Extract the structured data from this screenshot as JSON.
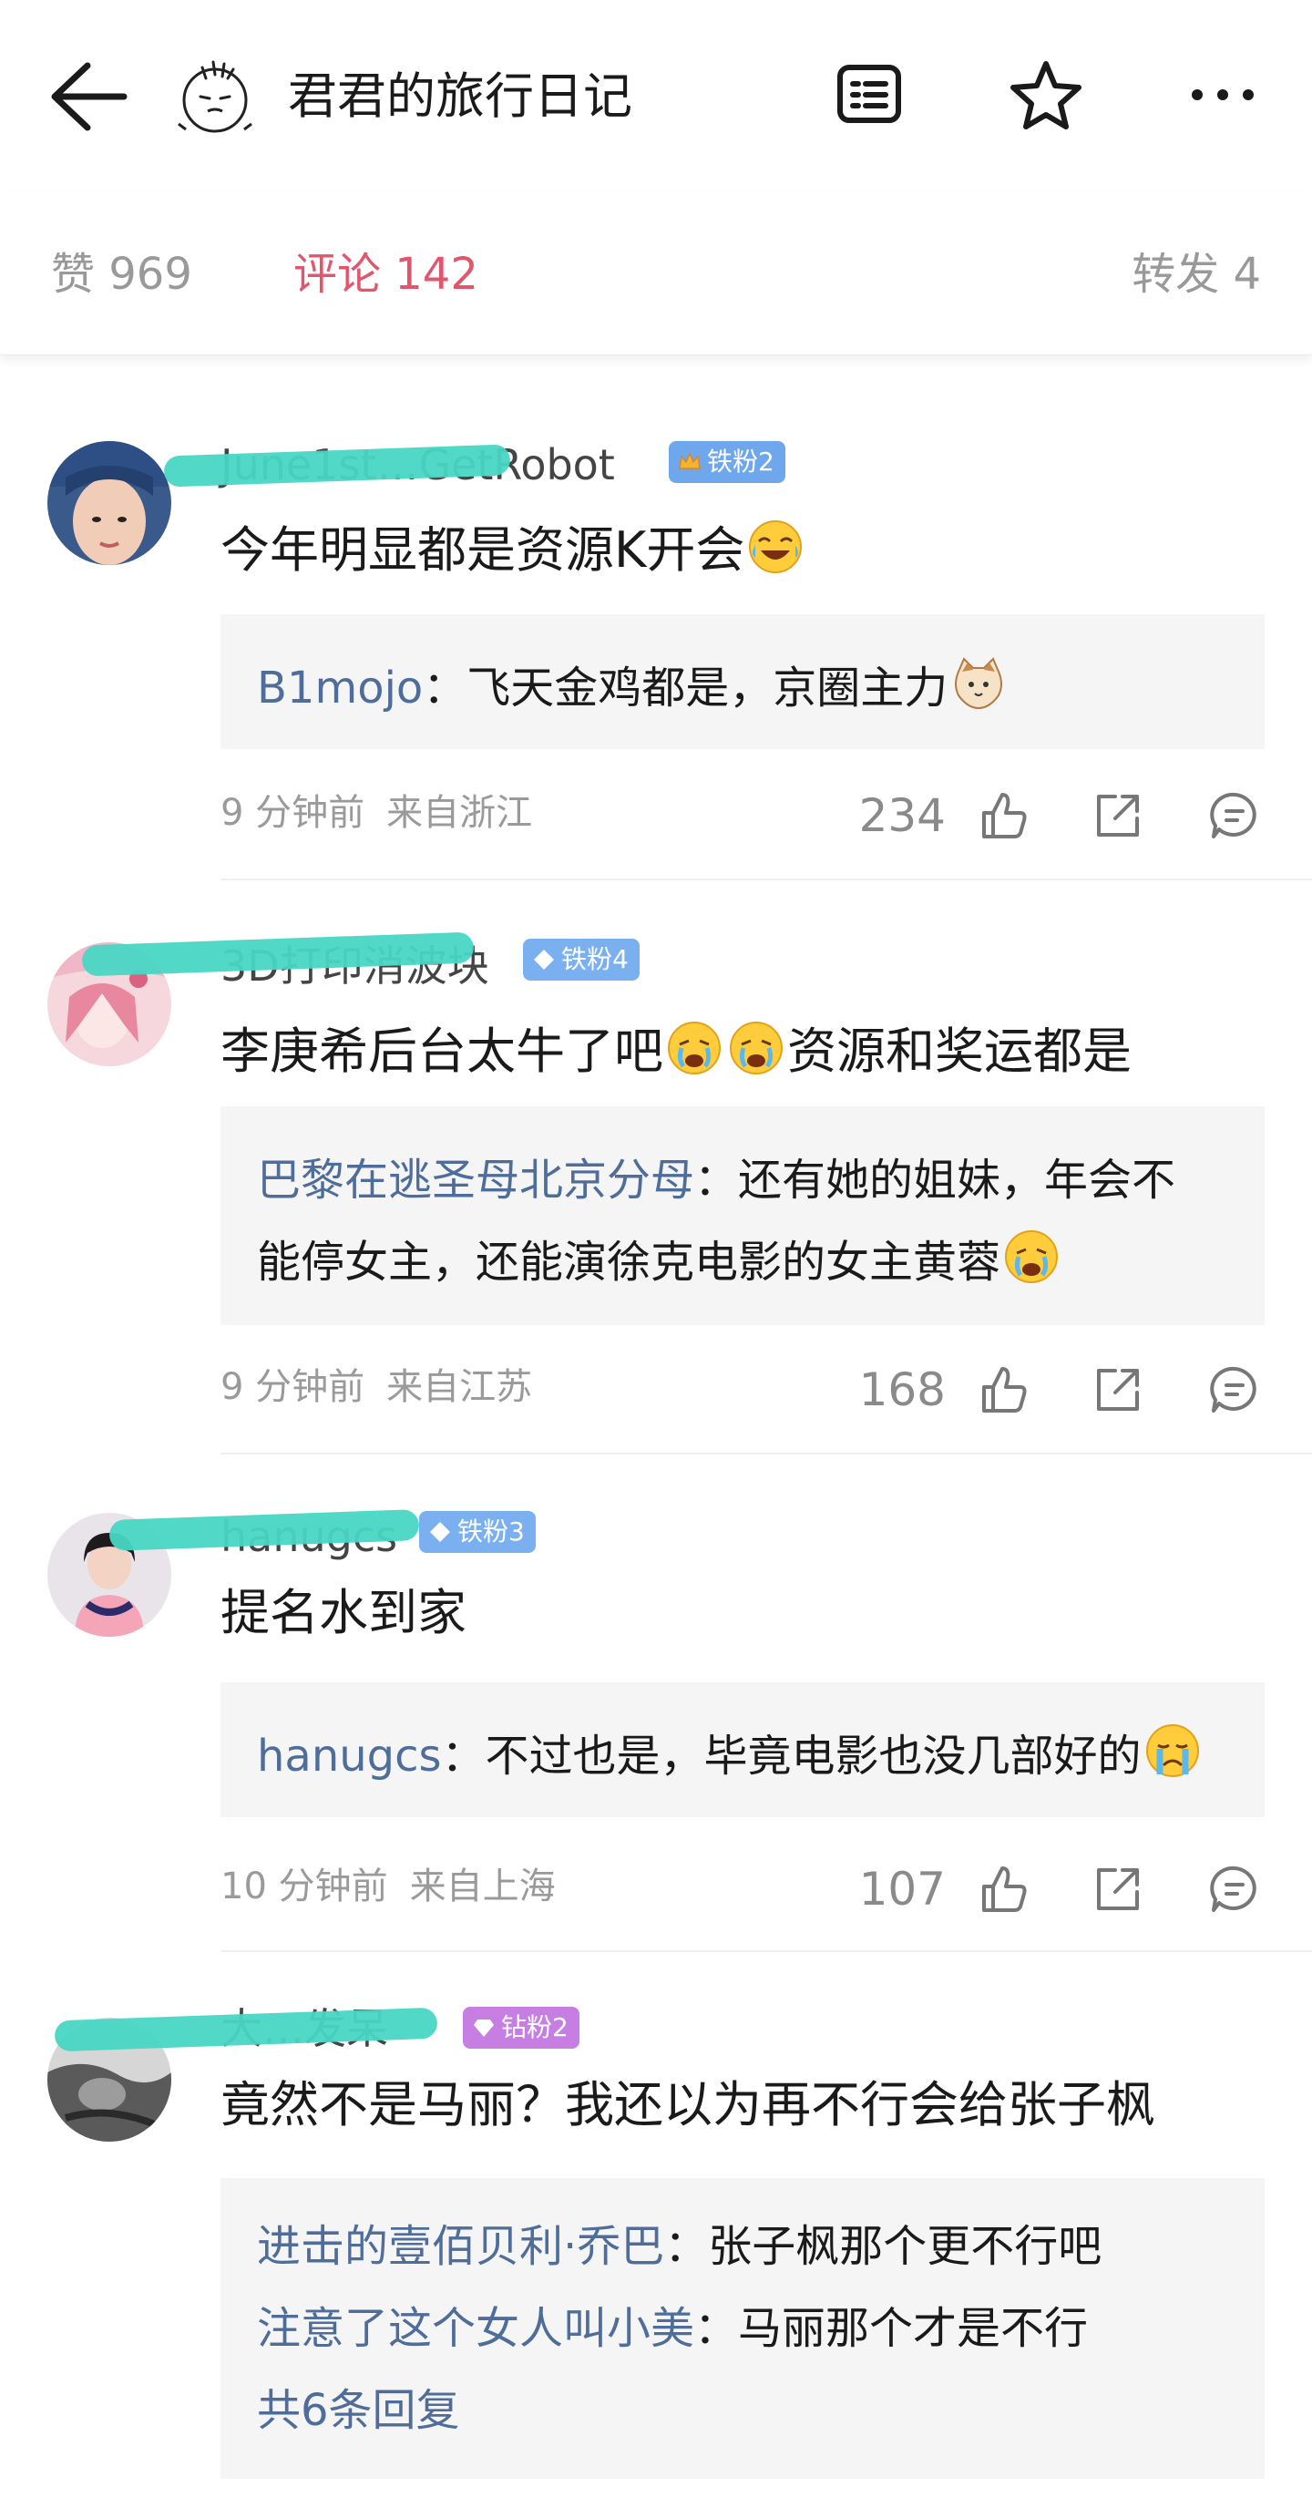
{
  "header": {
    "title": "君君的旅行日记",
    "icons": [
      "back-arrow-icon",
      "profile-avatar-icon",
      "list-icon",
      "star-icon",
      "more-icon"
    ]
  },
  "tabs": {
    "likes": "赞 969",
    "comments": "评论 142",
    "reposts": "转发 4",
    "active_color": "#e0566d"
  },
  "comments": [
    {
      "user": "June1st…GetRobot",
      "badge": "铁粉2",
      "text": "今年明显都是资源K开会",
      "replies": [
        {
          "user": "B1mojo",
          "text": "：飞天金鸡都是，京圈主力"
        }
      ],
      "time": "9 分钟前",
      "location": "来自浙江",
      "likes": "234"
    },
    {
      "user": "3D打印消波块",
      "badge": "铁粉4",
      "text": "李庚希后台太牛了吧",
      "text_suffix": "资源和奖运都是",
      "replies": [
        {
          "user": "巴黎在逃圣母北京分母",
          "text": "：还有她的姐妹，年会不",
          "text2": "能停女主，还能演徐克电影的女主黄蓉"
        }
      ],
      "time": "9 分钟前",
      "location": "来自江苏",
      "likes": "168"
    },
    {
      "user": "hanugcs",
      "badge": "铁粉3",
      "text": "提名水到家",
      "replies": [
        {
          "user": "hanugcs",
          "text": "：不过也是，毕竟电影也没几部好的"
        }
      ],
      "time": "10 分钟前",
      "location": "来自上海",
      "likes": "107"
    },
    {
      "user": "大…发呆",
      "badge": "钻粉2",
      "text": "竟然不是马丽？我还以为再不行会给张子枫",
      "replies": [
        {
          "user": "进击的壹佰贝利·乔巴",
          "text": "：张子枫那个更不行吧"
        },
        {
          "user": "注意了这个女人叫小美",
          "text": "：马丽那个才是不行"
        }
      ],
      "more_replies": "共6条回复"
    }
  ],
  "colors": {
    "reply_user": "#4f6d9a",
    "badge_blue": "#7ab0ef",
    "badge_gold": "#6ea7ec",
    "badge_purple": "#c77ee3",
    "scribble": "#49d6c4"
  }
}
